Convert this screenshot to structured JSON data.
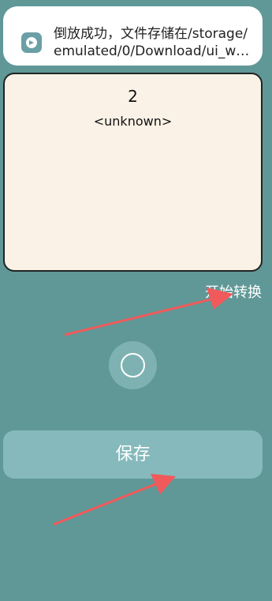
{
  "toast": {
    "icon": "app-icon",
    "line1": "倒放成功，文件存储在/storage/",
    "line2": "emulated/0/Download/ui_wi…"
  },
  "card": {
    "number": "2",
    "label": "<unknown>"
  },
  "actions": {
    "start_label": "开始转换",
    "save_label": "保存"
  },
  "colors": {
    "background": "#5f9897",
    "card": "#faf2e6",
    "save_button": "#86b9bb",
    "annotation_arrow": "#f05a5a"
  }
}
